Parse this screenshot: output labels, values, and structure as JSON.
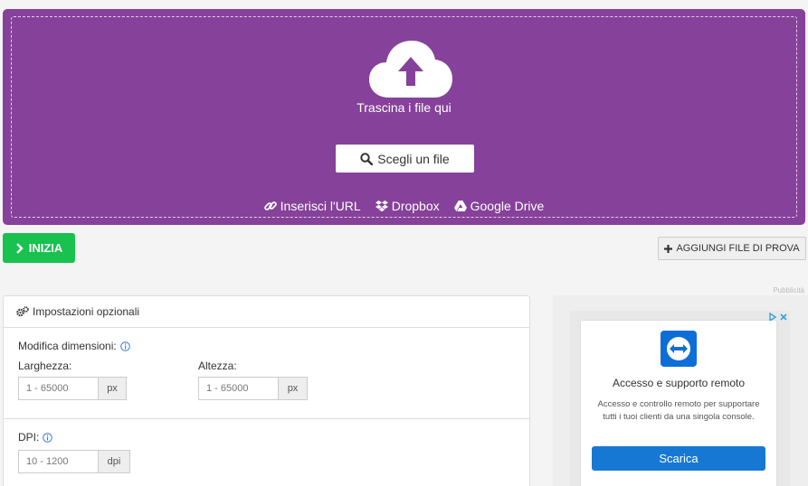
{
  "upload": {
    "drop_text": "Trascina i file qui",
    "choose_label": "Scegli un file",
    "sources": [
      {
        "label": "Inserisci l'URL",
        "icon": "link-icon"
      },
      {
        "label": "Dropbox",
        "icon": "dropbox-icon"
      },
      {
        "label": "Google Drive",
        "icon": "google-drive-icon"
      }
    ],
    "colors": {
      "background": "#86419a"
    }
  },
  "actions": {
    "start_label": "INIZIA",
    "add_sample_label": "AGGIUNGI FILE DI PROVA",
    "start_color": "#19c14f"
  },
  "ad_label": "Pubblicità",
  "settings": {
    "title": "Impostazioni opzionali",
    "resize_label": "Modifica dimensioni:",
    "width_label": "Larghezza:",
    "width_placeholder": "1 - 65000",
    "width_unit": "px",
    "height_label": "Altezza:",
    "height_placeholder": "1 - 65000",
    "height_unit": "px",
    "dpi_label": "DPI:",
    "dpi_placeholder": "10 - 1200",
    "dpi_unit": "dpi"
  },
  "ad": {
    "title": "Accesso e supporto remoto",
    "description": "Accesso e controllo remoto per supportare tutti i tuoi clienti da una singola console.",
    "button_label": "Scarica",
    "button_color": "#1778d4"
  }
}
